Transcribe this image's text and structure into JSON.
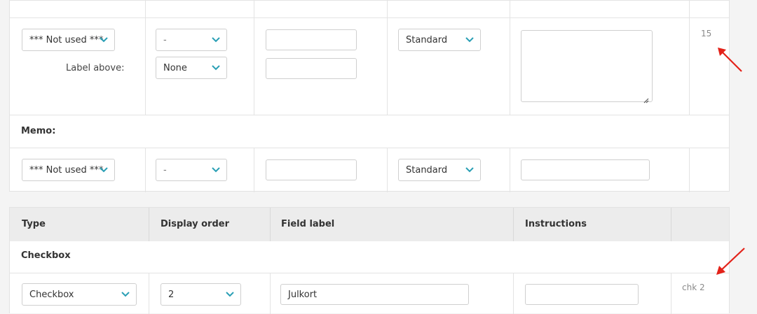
{
  "section1": {
    "row15": {
      "type_select": "*** Not used ***",
      "order_select": "-",
      "label_position_label": "Label above:",
      "label_position_select": "None",
      "style_select": "Standard",
      "id_text": "15"
    },
    "memo": {
      "section_label": "Memo:",
      "type_select": "*** Not used ***",
      "order_select": "-",
      "style_select": "Standard"
    }
  },
  "section2": {
    "headers": [
      "Type",
      "Display order",
      "Field label",
      "Instructions"
    ],
    "checkbox": {
      "section_label": "Checkbox",
      "type_select": "Checkbox",
      "order_select": "2",
      "field_label_value": "Julkort",
      "id_text": "chk 2"
    }
  },
  "colors": {
    "chevron": "#2a9fb5",
    "annotation_arrow": "#e32219",
    "header_bg": "#ececec",
    "border": "#e3e3e3"
  },
  "icons": [
    "chevron-down-icon",
    "resize-grip-icon",
    "red-arrow-annotation"
  ]
}
